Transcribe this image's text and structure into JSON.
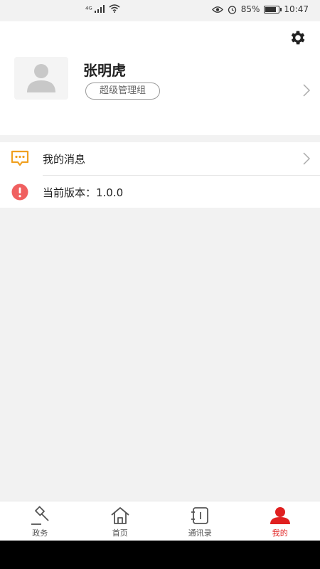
{
  "status_bar": {
    "network": "⁴ᴳ",
    "battery": "85%",
    "time": "10:47",
    "battery_level": 0.85
  },
  "profile": {
    "name": "张明虎",
    "role": "超级管理组"
  },
  "menu": {
    "items": [
      {
        "label": "我的消息",
        "icon": "message-icon"
      },
      {
        "label": "当前版本：1.0.0",
        "icon": "alert-icon"
      }
    ]
  },
  "tabbar": {
    "tabs": [
      {
        "label": "政务",
        "icon": "gavel-icon",
        "active": false
      },
      {
        "label": "首页",
        "icon": "home-icon",
        "active": false
      },
      {
        "label": "通讯录",
        "icon": "contacts-icon",
        "active": false
      },
      {
        "label": "我的",
        "icon": "user-icon",
        "active": true
      }
    ]
  },
  "colors": {
    "accent": "#e02020",
    "message_icon": "#f0a020",
    "alert_icon": "#f06060"
  }
}
